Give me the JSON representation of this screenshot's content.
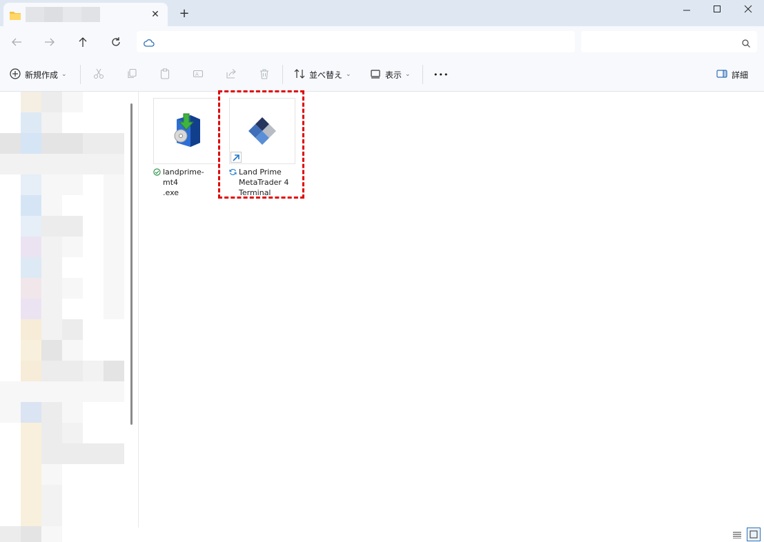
{
  "window": {
    "tab": {
      "title": "",
      "folder_icon": "folder-icon",
      "close_glyph": "✕"
    },
    "new_tab_glyph": "+",
    "controls": {
      "minimize": "minimize-icon",
      "maximize": "maximize-icon",
      "close": "close-icon"
    }
  },
  "address_bar": {
    "path": "",
    "location_icon": "cloud-icon",
    "search_placeholder": ""
  },
  "command_bar": {
    "new_label": "新規作成",
    "sort_label": "並べ替え",
    "view_label": "表示",
    "more_label": "•••",
    "details_label": "詳細"
  },
  "files": [
    {
      "name": "landprime-mt4\n.exe",
      "display_name": "landprime-mt4\n.exe",
      "status": "available-icon",
      "type": "installer"
    },
    {
      "name": "Land Prime\nMetaTrader 4\nTerminal",
      "status": "sync-icon",
      "type": "shortcut",
      "highlighted": true
    }
  ],
  "colors": {
    "accent": "#2f6fb5",
    "highlight": "#e00000",
    "titlebar": "#dfe8f2",
    "toolbar": "#f7f9fc"
  },
  "view": {
    "mode": "large-icons"
  }
}
